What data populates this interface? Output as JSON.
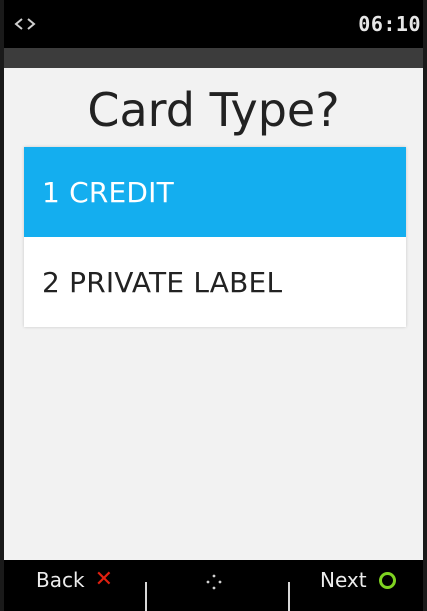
{
  "status_bar": {
    "time": "06:10",
    "connection_icon": "link-arrows-icon"
  },
  "screen": {
    "title": "Card Type?",
    "options": [
      {
        "label": "1 CREDIT",
        "selected": true
      },
      {
        "label": "2 PRIVATE LABEL",
        "selected": false
      }
    ]
  },
  "softkeys": {
    "back_label": "Back",
    "back_icon": "cancel-x-icon",
    "nav_icon": "navigation-dots-icon",
    "next_label": "Next",
    "next_icon": "confirm-o-icon"
  },
  "colors": {
    "selected_bg": "#14aeef",
    "cancel": "#e02010",
    "confirm": "#7fd321",
    "bar": "#000000"
  }
}
